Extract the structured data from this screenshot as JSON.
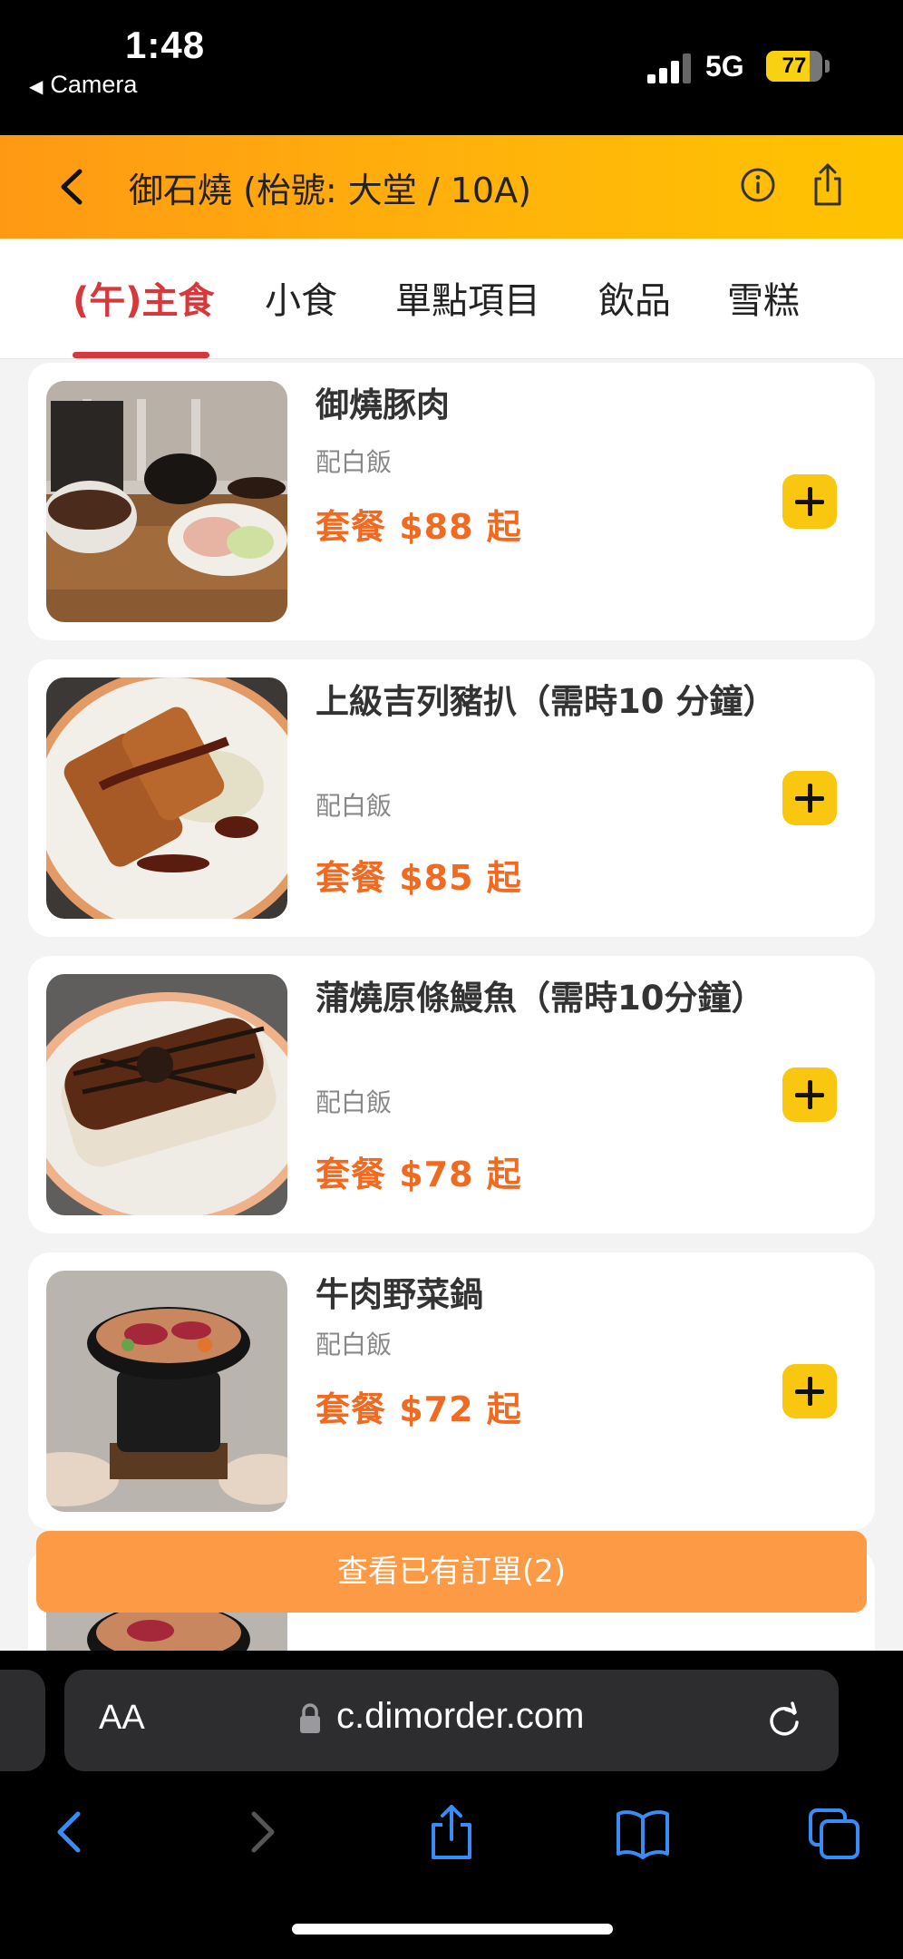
{
  "status_bar": {
    "time": "1:48",
    "back_label": "Camera",
    "back_glyph": "◀",
    "network": "5G",
    "battery": "77",
    "battery_level": 0.77
  },
  "header": {
    "title": "御石燒 (枱號: 大堂 / 10A)",
    "back_icon": "chevron-left-icon",
    "info_icon": "info-icon",
    "share_icon": "share-icon"
  },
  "tabs": [
    {
      "label": "(午)主食",
      "active": true
    },
    {
      "label": "小食",
      "active": false
    },
    {
      "label": "單點項目",
      "active": false
    },
    {
      "label": "飲品",
      "active": false
    },
    {
      "label": "雪糕",
      "active": false
    }
  ],
  "menu_items": [
    {
      "name": "御燒豚肉",
      "desc": "配白飯",
      "price": "套餐 $88 起"
    },
    {
      "name": "上級吉列豬扒（需時10 分鐘）",
      "desc": "配白飯",
      "price": "套餐 $85 起"
    },
    {
      "name": "蒲燒原條鰻魚（需時10分鐘）",
      "desc": "配白飯",
      "price": "套餐 $78 起"
    },
    {
      "name": "牛肉野菜鍋",
      "desc": "配白飯",
      "price": "套餐 $72 起"
    }
  ],
  "order_button": {
    "label": "查看已有訂單(2)"
  },
  "browser": {
    "text_size_label": "AA",
    "url": "c.dimorder.com",
    "icons": [
      "lock-icon",
      "reload-icon",
      "back-icon",
      "forward-icon",
      "share-icon",
      "bookmarks-icon",
      "tabs-icon"
    ]
  },
  "colors": {
    "accent": "#d7383b",
    "price": "#f06a22",
    "add_button": "#f9c710",
    "order_bar": "#fd9a45",
    "browser_link": "#3a8cf5"
  }
}
